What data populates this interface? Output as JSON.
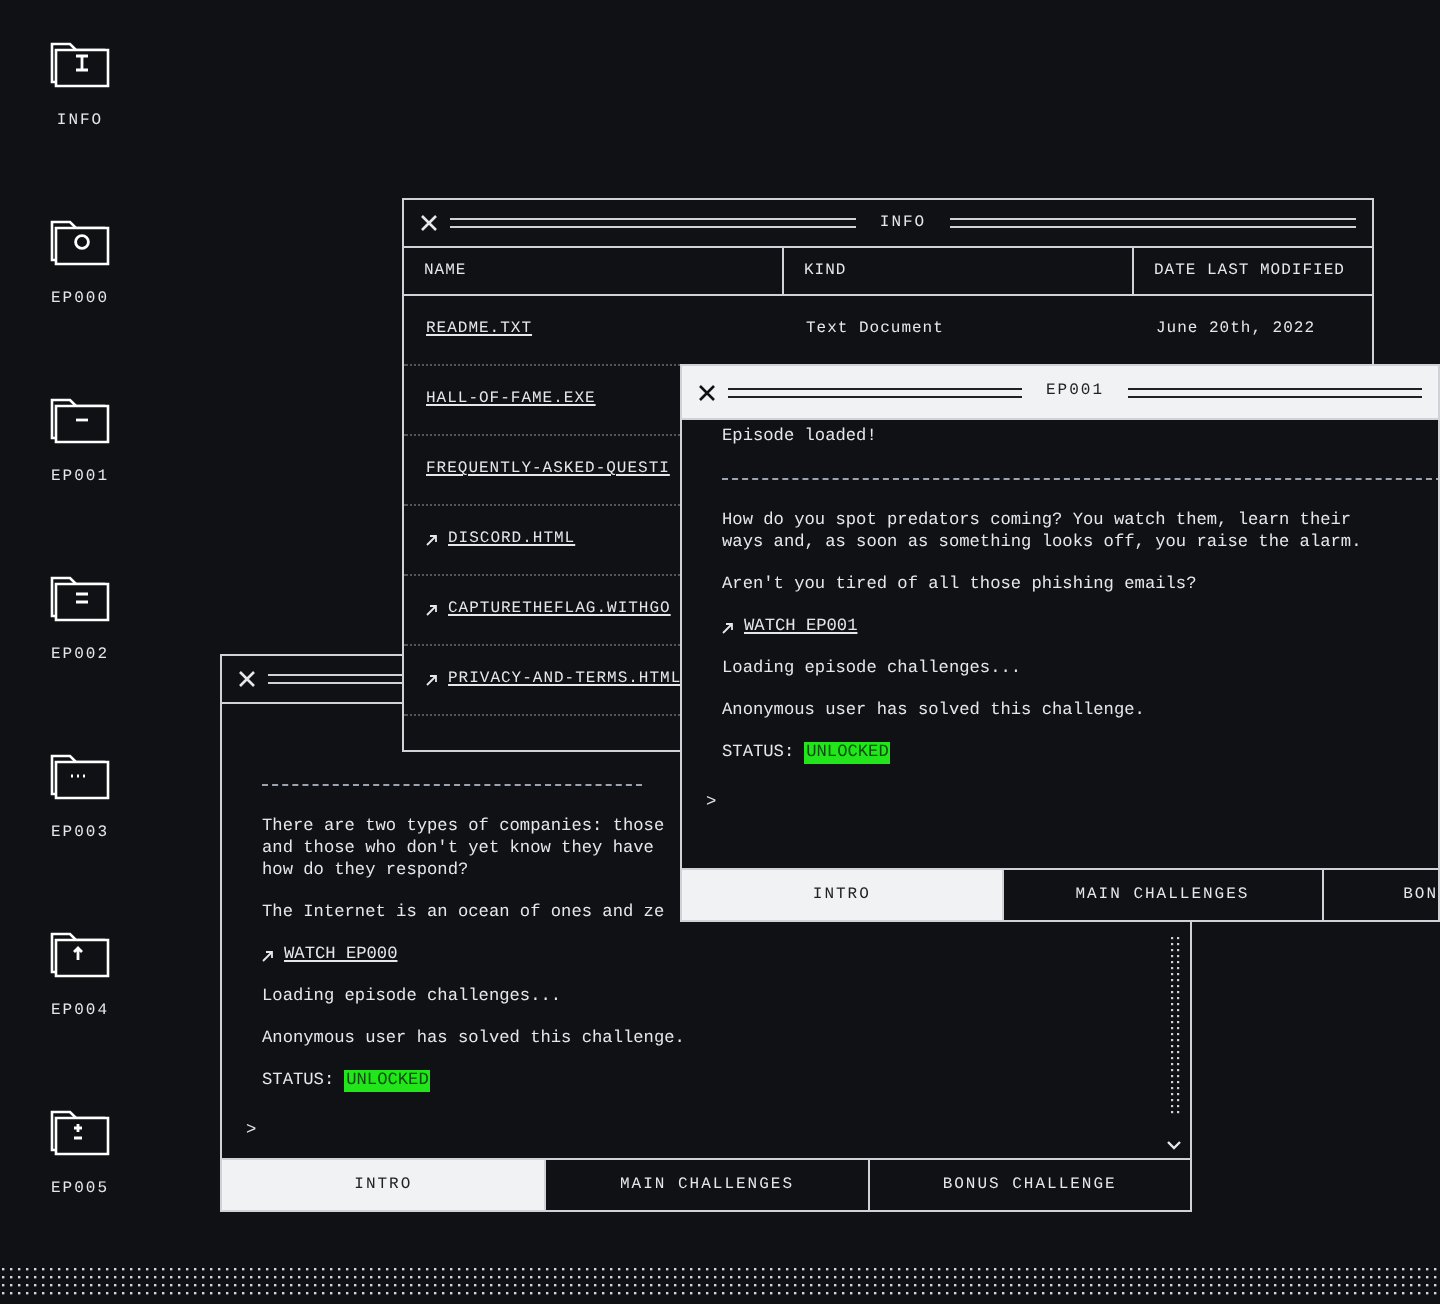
{
  "desktop_icons": [
    {
      "label": "INFO",
      "kind": "text"
    },
    {
      "label": "EP000",
      "kind": "circle"
    },
    {
      "label": "EP001",
      "kind": "minus"
    },
    {
      "label": "EP002",
      "kind": "lines"
    },
    {
      "label": "EP003",
      "kind": "dots"
    },
    {
      "label": "EP004",
      "kind": "up"
    },
    {
      "label": "EP005",
      "kind": "plusminus"
    }
  ],
  "windows": [
    {
      "kind": "terminal",
      "active": false,
      "lines": [
        {
          "kind": "rule"
        },
        {
          "kind": "text",
          "text": "There are two types of companies: those\nand those who don't yet know they have\nhow do they respond?"
        },
        {
          "kind": "text",
          "text": "The Internet is an ocean of ones and ze"
        },
        {
          "kind": "link",
          "text": "WATCH EP000"
        },
        {
          "kind": "text",
          "text": "Loading episode challenges..."
        },
        {
          "kind": "text",
          "text": "Anonymous user has solved this challenge."
        },
        {
          "kind": "status",
          "text": "STATUS:",
          "value": "UNLOCKED"
        },
        {
          "kind": "prompt",
          "text": ">"
        }
      ],
      "tabs": [
        {
          "label": "INTRO",
          "selected": true
        },
        {
          "label": "MAIN CHALLENGES",
          "selected": false
        },
        {
          "label": "BONUS CHALLENGE",
          "selected": false
        }
      ]
    },
    {
      "kind": "table",
      "title": "INFO",
      "active": false,
      "columns": [
        "NAME",
        "KIND",
        "DATE LAST MODIFIED"
      ],
      "rows": [
        {
          "name": "README.TXT",
          "external": false,
          "file_kind": "Text Document",
          "modified": "June 20th, 2022"
        },
        {
          "name": "HALL-OF-FAME.EXE",
          "external": false
        },
        {
          "name": "FREQUENTLY-ASKED-QUESTI",
          "external": false
        },
        {
          "name": "DISCORD.HTML",
          "external": true
        },
        {
          "name": "CAPTURETHEFLAG.WITHGO",
          "external": true
        },
        {
          "name": "PRIVACY-AND-TERMS.HTML",
          "external": true
        }
      ]
    },
    {
      "kind": "terminal",
      "title": "EP001",
      "active": true,
      "lines": [
        {
          "kind": "text",
          "text": "Episode loaded!"
        },
        {
          "kind": "rule"
        },
        {
          "kind": "text",
          "text": "How do you spot predators coming? You watch them, learn their\nways and, as soon as something looks off, you raise the alarm."
        },
        {
          "kind": "text",
          "text": "Aren't you tired of all those phishing emails?"
        },
        {
          "kind": "link",
          "text": "WATCH EP001"
        },
        {
          "kind": "text",
          "text": "Loading episode challenges..."
        },
        {
          "kind": "text",
          "text": "Anonymous user has solved this challenge."
        },
        {
          "kind": "status",
          "text": "STATUS:",
          "value": "UNLOCKED"
        },
        {
          "kind": "prompt",
          "text": ">"
        }
      ],
      "tabs": [
        {
          "label": "INTRO",
          "selected": true
        },
        {
          "label": "MAIN CHALLENGES",
          "selected": false
        },
        {
          "label": "BON",
          "selected": false,
          "clipped": true
        }
      ]
    }
  ]
}
